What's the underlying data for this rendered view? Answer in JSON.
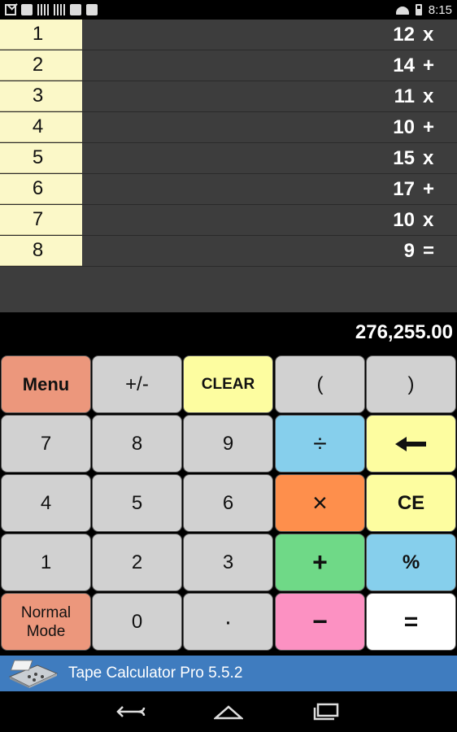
{
  "status_bar": {
    "time": "8:15"
  },
  "tape": [
    {
      "line": "1",
      "value": "12",
      "op": "x"
    },
    {
      "line": "2",
      "value": "14",
      "op": "+"
    },
    {
      "line": "3",
      "value": "11",
      "op": "x"
    },
    {
      "line": "4",
      "value": "10",
      "op": "+"
    },
    {
      "line": "5",
      "value": "15",
      "op": "x"
    },
    {
      "line": "6",
      "value": "17",
      "op": "+"
    },
    {
      "line": "7",
      "value": "10",
      "op": "x"
    },
    {
      "line": "8",
      "value": "9",
      "op": "="
    }
  ],
  "result": "276,255.00",
  "keys": {
    "menu": "Menu",
    "plus_minus": "+/-",
    "clear": "CLEAR",
    "open_paren": "(",
    "close_paren": ")",
    "seven": "7",
    "eight": "8",
    "nine": "9",
    "divide": "÷",
    "four": "4",
    "five": "5",
    "six": "6",
    "multiply": "×",
    "ce": "CE",
    "one": "1",
    "two": "2",
    "three": "3",
    "add": "+",
    "percent": "%",
    "normal_mode_line1": "Normal",
    "normal_mode_line2": "Mode",
    "zero": "0",
    "decimal": "·",
    "subtract": "−",
    "equals": "="
  },
  "app_bar": {
    "title": "Tape Calculator Pro  5.5.2"
  },
  "icons": {
    "backspace": "backspace-arrow-icon",
    "app_icon": "adding-machine-icon",
    "nav_back": "back-icon",
    "nav_home": "home-icon",
    "nav_recents": "recents-icon"
  },
  "colors": {
    "tape_background": "#3d3d3d",
    "line_number_background": "#fbf8c8",
    "menu_key": "#ec977c",
    "clear_key": "#fdfda0",
    "divide_key": "#86cfec",
    "multiply_key": "#fe8f4c",
    "add_key": "#6fd987",
    "subtract_key": "#fc91c2",
    "app_bar": "#3f7cbf"
  }
}
